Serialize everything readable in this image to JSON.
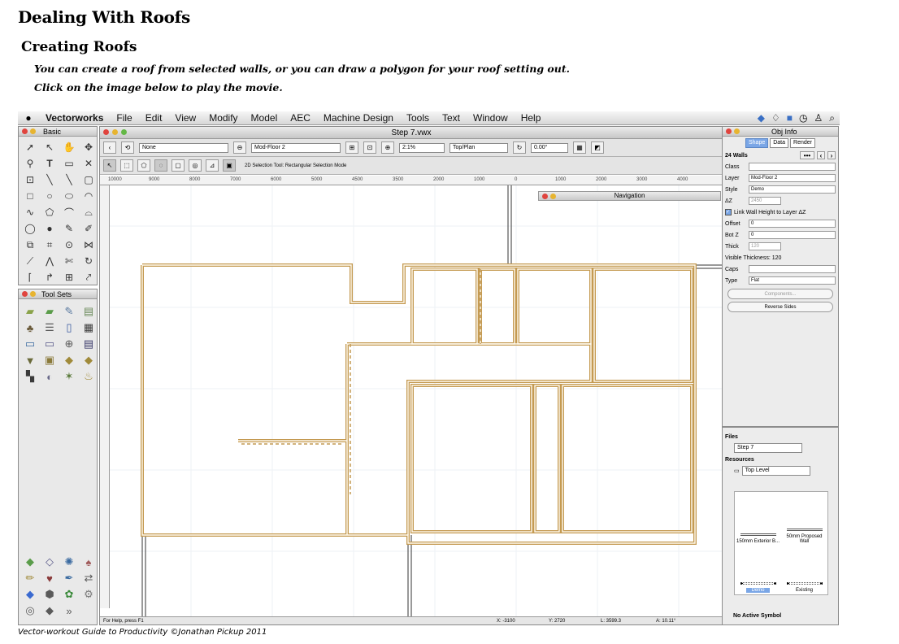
{
  "page": {
    "title": "Dealing With Roofs",
    "subtitle": "Creating Roofs",
    "lines": [
      "You can create a roof from selected walls, or you can draw a polygon for your roof setting out.",
      "Click on the image below to play the movie."
    ],
    "footer": "Vector-workout Guide to Productivity ©Jonathan Pickup 2011"
  },
  "menubar": {
    "items": [
      "Vectorworks",
      "File",
      "Edit",
      "View",
      "Modify",
      "Model",
      "AEC",
      "Machine Design",
      "Tools",
      "Text",
      "Window",
      "Help"
    ]
  },
  "basic_palette": {
    "title": "Basic"
  },
  "toolsets_palette": {
    "title": "Tool Sets"
  },
  "document": {
    "title": "Step 7.vwx",
    "class_value": "None",
    "layer_value": "Mod-Floor 2",
    "zoom_value": "2:1%",
    "view_value": "Top/Plan",
    "angle_value": "0.00°",
    "mode_text": "2D Selection Tool: Rectangular Selection Mode",
    "status_help": "For Help, press F1",
    "status_x": "X: -3100",
    "status_y": "Y: 2720",
    "status_l": "L: 3599.3",
    "status_a": "A: 10.11°",
    "ruler_ticks": [
      "10000",
      "9000",
      "8000",
      "7000",
      "6000",
      "5000",
      "4500",
      "3500",
      "2000",
      "1000",
      "0",
      "1000",
      "2000",
      "3000",
      "4000",
      "5000"
    ]
  },
  "navigation": {
    "title": "Navigation"
  },
  "obj_info": {
    "title": "Obj Info",
    "tabs": [
      "Shape",
      "Data",
      "Render"
    ],
    "selection": "24 Walls",
    "class_label": "Class",
    "layer_label": "Layer",
    "layer_value": "Mod-Floor 2",
    "style_label": "Style",
    "style_value": "Demo",
    "dz_label": "ΔZ",
    "dz_value": "2450",
    "link_label": "Link Wall Height to Layer ΔZ",
    "offset_label": "Offset",
    "offset_value": "0",
    "botz_label": "Bot Z",
    "botz_value": "0",
    "thick_label": "Thick",
    "thick_value": "120",
    "visible_thickness": "Visible Thickness: 120",
    "caps_label": "Caps",
    "type_label": "Type",
    "type_value": "Flat",
    "components_button": "Components...",
    "reverse_button": "Reverse Sides"
  },
  "resource_browser": {
    "files_label": "Files",
    "file_value": "Step 7",
    "resources_label": "Resources",
    "level_value": "Top Level",
    "items": [
      "150mm Exterior B...",
      "50mm Proposed Wall",
      "Demo",
      "Existing"
    ],
    "no_symbol": "No Active Symbol"
  },
  "colors": {
    "wall": "#b58b4c",
    "wall_fill": "#fffdf6",
    "menubar": "#e4e4e4"
  }
}
